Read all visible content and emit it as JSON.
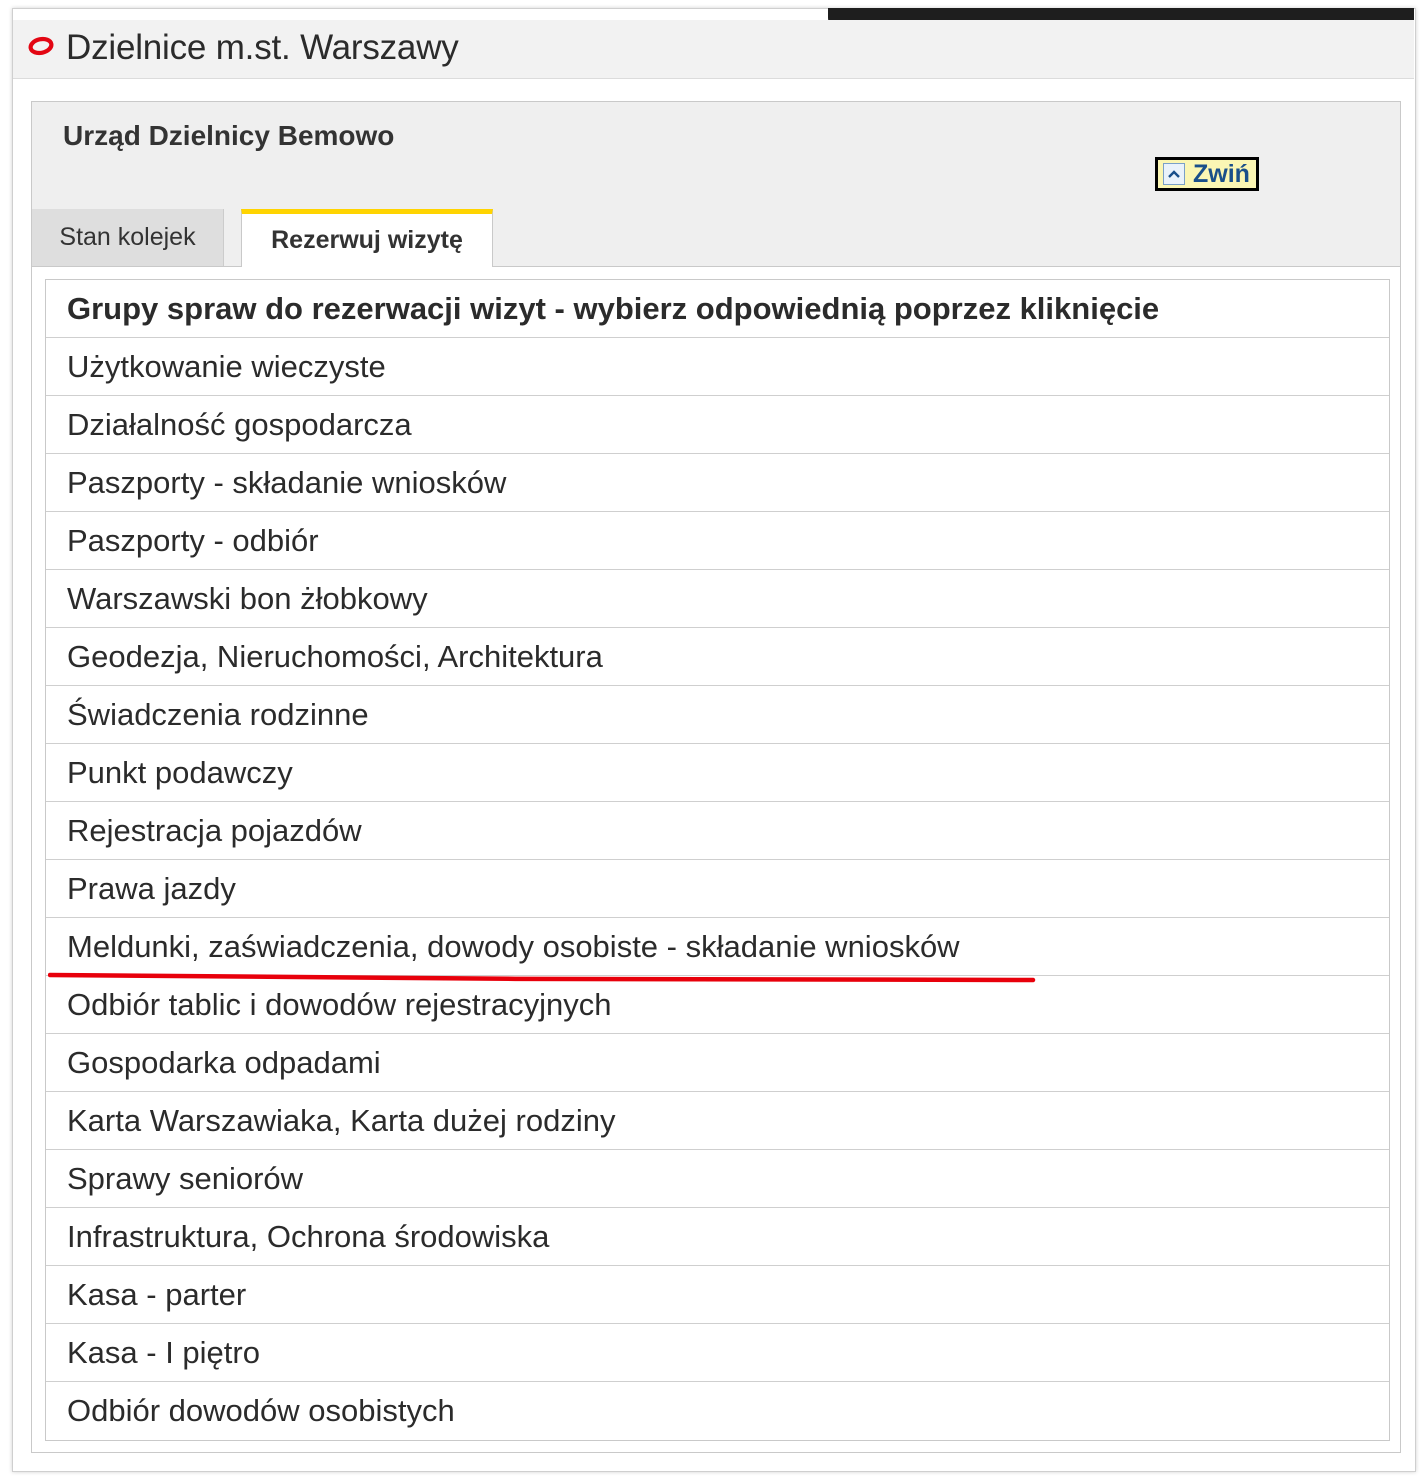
{
  "header": {
    "title": "Dzielnice m.st. Warszawy",
    "logo_icon": "warsaw-logo-icon",
    "accent_color": "#e30613"
  },
  "panel": {
    "office_name": "Urząd Dzielnicy Bemowo",
    "collapse": {
      "label": "Zwiń",
      "icon": "chevron-up-icon"
    },
    "tabs": [
      {
        "label": "Stan kolejek",
        "active": false
      },
      {
        "label": "Rezerwuj wizytę",
        "active": true,
        "accent_color": "#ffd400"
      }
    ]
  },
  "list": {
    "header": "Grupy spraw do rezerwacji wizyt - wybierz odpowiednią poprzez kliknięcie",
    "items": [
      "Użytkowanie wieczyste",
      "Działalność gospodarcza",
      "Paszporty - składanie wniosków",
      "Paszporty - odbiór",
      "Warszawski bon żłobkowy",
      "Geodezja, Nieruchomości, Architektura",
      "Świadczenia rodzinne",
      "Punkt podawczy",
      "Rejestracja pojazdów",
      "Prawa jazdy",
      "Meldunki, zaświadczenia, dowody osobiste - składanie wniosków",
      "Odbiór tablic i dowodów rejestracyjnych",
      "Gospodarka odpadami",
      "Karta Warszawiaka, Karta dużej rodziny",
      "Sprawy seniorów",
      "Infrastruktura, Ochrona środowiska",
      "Kasa - parter",
      "Kasa - I piętro",
      "Odbiór dowodów osobistych"
    ],
    "highlighted_item_index": 10,
    "highlight_color": "#e8000b"
  }
}
